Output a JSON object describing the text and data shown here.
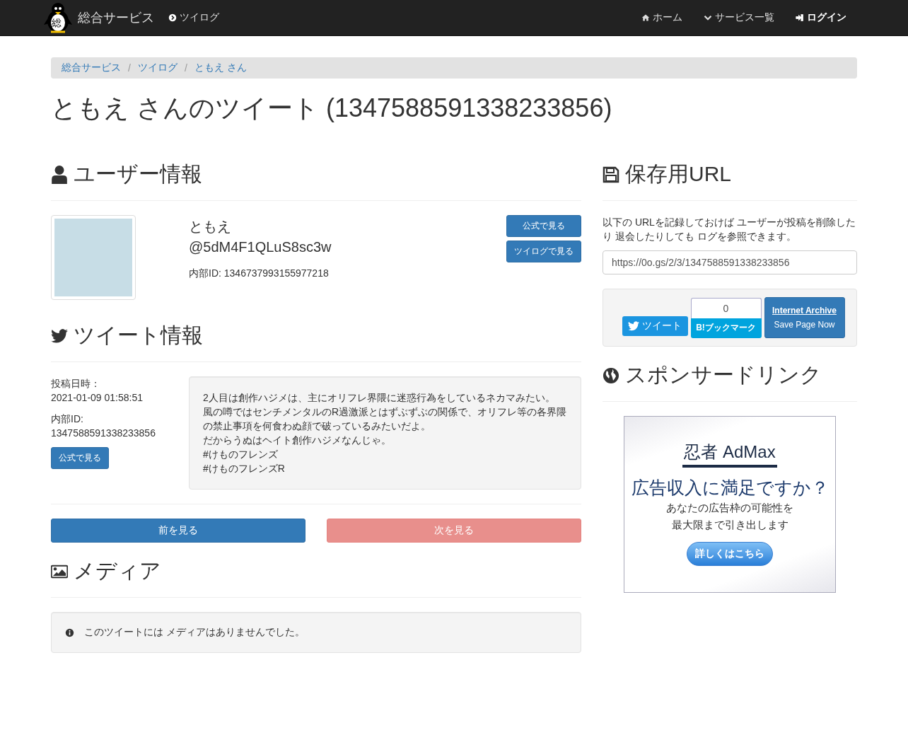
{
  "navbar": {
    "logo_mark": "総",
    "brand": "総合サービス",
    "left_links": [
      {
        "label": "ツイログ"
      }
    ],
    "right_links": [
      {
        "label": "ホーム",
        "bold": false
      },
      {
        "label": "サービス一覧",
        "bold": false
      },
      {
        "label": "ログイン",
        "bold": true
      }
    ]
  },
  "breadcrumb": {
    "separator": "/",
    "items": [
      "総合サービス",
      "ツイログ",
      "ともえ さん"
    ]
  },
  "page_title": "ともえ さんのツイート (1347588591338233856)",
  "user_section": {
    "heading": "ユーザー情報",
    "display_name": "ともえ",
    "screen_name": "@5dM4F1QLuS8sc3w",
    "internal_id": "内部ID: 1346737993155977218",
    "buttons": [
      "公式で見る",
      "ツイログで見る"
    ]
  },
  "tweet_section": {
    "heading": "ツイート情報",
    "posted_label": "投稿日時：",
    "posted_at": "2021-01-09 01:58:51",
    "id_label": "内部ID:",
    "id_value": "1347588591338233856",
    "button": "公式で見る",
    "text_lines": [
      "2人目は創作ハジメは、主にオリフレ界隈に迷惑行為をしているネカマみたい。",
      "風の噂ではセンチメンタルのR過激派とはずぶずぶの関係で、オリフレ等の各界隈の禁止事項を何食わぬ顔で破っているみたいだよ。",
      "だからうぬはヘイト創作ハジメなんじゃ。",
      "#けものフレンズ",
      "#けものフレンズR"
    ]
  },
  "pager": [
    {
      "label": "前を見る",
      "disabled": false
    },
    {
      "label": "次を見る",
      "disabled": true
    }
  ],
  "media_section": {
    "heading": "メディア",
    "notice": "このツイートには メディアはありませんでした。"
  },
  "save_section": {
    "heading": "保存用URL",
    "description": "以下の URLを記録しておけば ユーザーが投稿を削除したり 退会したりしても ログを参照できます。",
    "url": "https://0o.gs/2/3/1347588591338233856",
    "tweet_button": "ツイート",
    "bookmark_count": "0",
    "bookmark_button": "B!ブックマーク",
    "archive_title": "Internet Archive",
    "archive_action": "Save Page Now"
  },
  "sponsor_section": {
    "heading": "スポンサードリンク",
    "ad_logo": "忍者 AdMax",
    "ad_headline": "広告収入に満足ですか？",
    "ad_lines": [
      "あなたの広告枠の可能性を",
      "最大限まで引き出します"
    ],
    "ad_button": "詳しくはこちら"
  }
}
